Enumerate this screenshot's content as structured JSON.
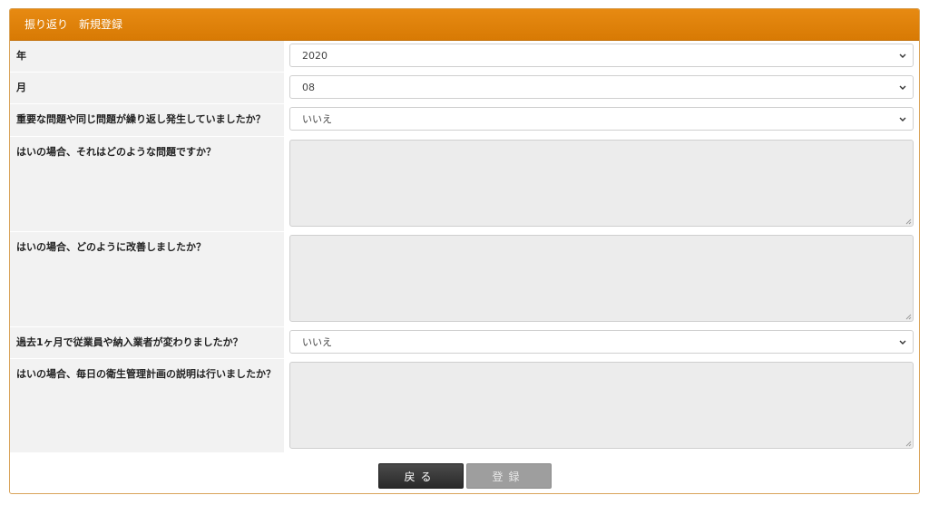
{
  "header": {
    "title": "振り返り　新規登録"
  },
  "fields": {
    "year": {
      "label": "年",
      "value": "2020"
    },
    "month": {
      "label": "月",
      "value": "08"
    },
    "q1": {
      "label": "重要な問題や同じ問題が繰り返し発生していましたか？",
      "value": "いいえ"
    },
    "q1a": {
      "label": "はいの場合、それはどのような問題ですか？",
      "value": ""
    },
    "q1b": {
      "label": "はいの場合、どのように改善しましたか？",
      "value": ""
    },
    "q2": {
      "label": "過去1ヶ月で従業員や納入業者が変わりましたか？",
      "value": "いいえ"
    },
    "q2a": {
      "label": "はいの場合、毎日の衛生管理計画の説明は行いましたか？",
      "value": ""
    }
  },
  "buttons": {
    "back_label": "戻る",
    "submit_label": "登録"
  },
  "colors": {
    "header": "#e0820a",
    "label_bg": "#f2f2f2",
    "textarea_bg": "#ececec",
    "back_button": "#333333",
    "submit_button": "#9e9e9e"
  },
  "icons": {
    "select_arrow": "chevron-down-icon",
    "resize": "resize-grip-icon"
  }
}
